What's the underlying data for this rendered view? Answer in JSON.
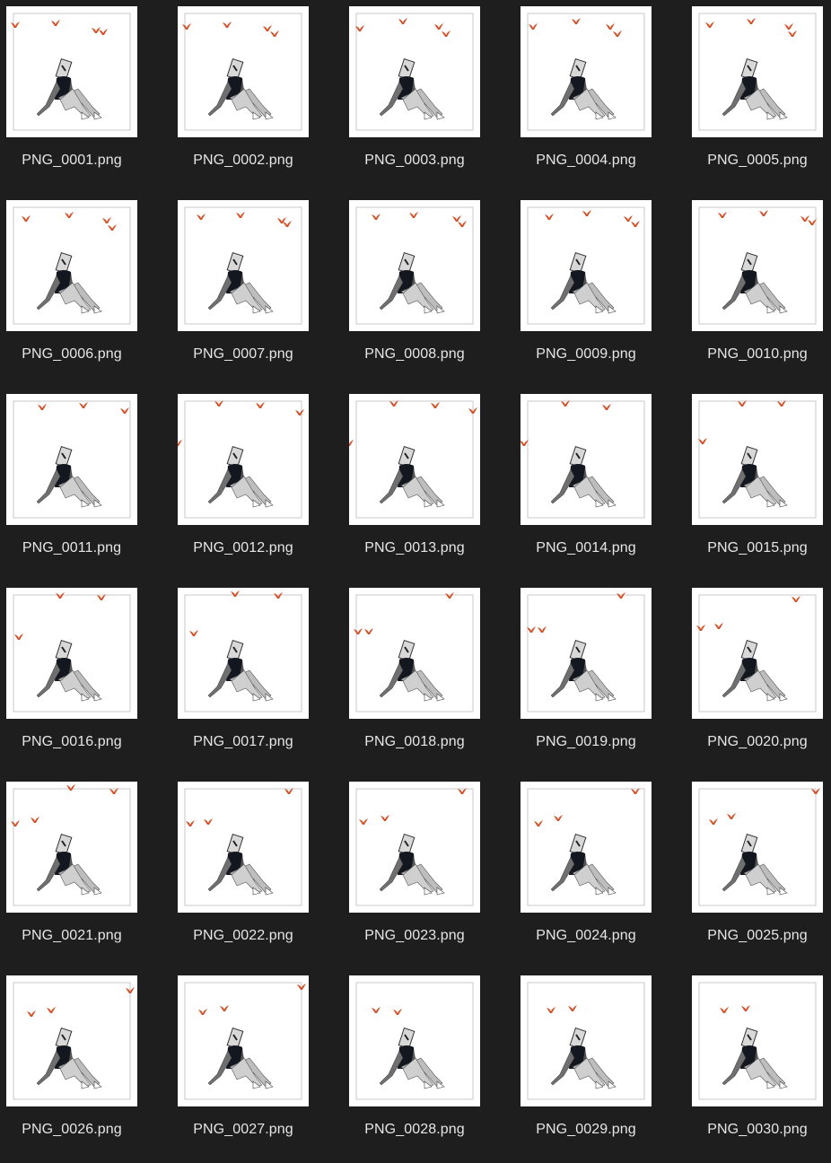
{
  "window": {
    "view": "icon-grid"
  },
  "colors": {
    "background": "#1e1e1e",
    "bird": "#d2532b",
    "label": "#e6e6e6"
  },
  "thumbnail_icons": [
    "frame-thumbnail",
    "sitting-figure-icon",
    "bird-icon"
  ],
  "files": [
    {
      "name": "PNG_0001.png"
    },
    {
      "name": "PNG_0002.png"
    },
    {
      "name": "PNG_0003.png"
    },
    {
      "name": "PNG_0004.png"
    },
    {
      "name": "PNG_0005.png"
    },
    {
      "name": "PNG_0006.png"
    },
    {
      "name": "PNG_0007.png"
    },
    {
      "name": "PNG_0008.png"
    },
    {
      "name": "PNG_0009.png"
    },
    {
      "name": "PNG_0010.png"
    },
    {
      "name": "PNG_0011.png"
    },
    {
      "name": "PNG_0012.png"
    },
    {
      "name": "PNG_0013.png"
    },
    {
      "name": "PNG_0014.png"
    },
    {
      "name": "PNG_0015.png"
    },
    {
      "name": "PNG_0016.png"
    },
    {
      "name": "PNG_0017.png"
    },
    {
      "name": "PNG_0018.png"
    },
    {
      "name": "PNG_0019.png"
    },
    {
      "name": "PNG_0020.png"
    },
    {
      "name": "PNG_0021.png"
    },
    {
      "name": "PNG_0022.png"
    },
    {
      "name": "PNG_0023.png"
    },
    {
      "name": "PNG_0024.png"
    },
    {
      "name": "PNG_0025.png"
    },
    {
      "name": "PNG_0026.png"
    },
    {
      "name": "PNG_0027.png"
    },
    {
      "name": "PNG_0028.png"
    },
    {
      "name": "PNG_0029.png"
    },
    {
      "name": "PNG_0030.png"
    }
  ]
}
